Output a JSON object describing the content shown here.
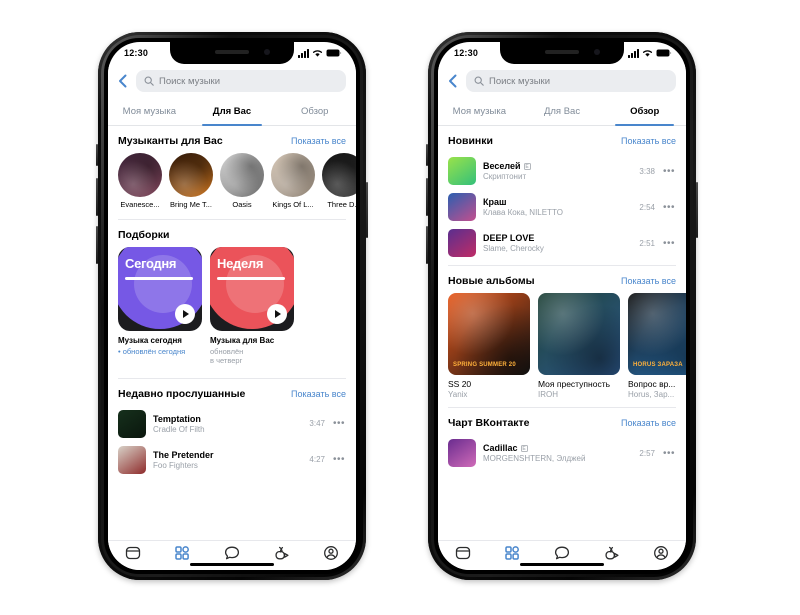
{
  "phones": [
    {
      "id": "phone-left",
      "status": {
        "time": "12:30",
        "signal_icon": "cellular-bars-icon",
        "wifi_icon": "wifi-icon",
        "battery_icon": "battery-full-icon"
      },
      "nav": {
        "back_icon": "back-chevron-icon"
      },
      "search": {
        "icon": "search-icon",
        "placeholder": "Поиск музыки",
        "value": ""
      },
      "tabs": [
        {
          "label": "Моя музыка",
          "active": false
        },
        {
          "label": "Для Вас",
          "active": true
        },
        {
          "label": "Обзор",
          "active": false
        }
      ],
      "sections": [
        {
          "kind": "artists",
          "title": "Музыканты для Вас",
          "link": "Показать все",
          "items": [
            {
              "name": "Evanesce...",
              "c1": "#3a2236",
              "c2": "#7d4458"
            },
            {
              "name": "Bring Me T...",
              "c1": "#2b1508",
              "c2": "#c8731f"
            },
            {
              "name": "Oasis",
              "c1": "#d8d8d8",
              "c2": "#6b6b6b"
            },
            {
              "name": "Kings Of L...",
              "c1": "#d9cbbb",
              "c2": "#8f8274"
            },
            {
              "name": "Three D...",
              "c1": "#141414",
              "c2": "#3d3d3d"
            }
          ]
        },
        {
          "kind": "cards",
          "title": "Подборки",
          "link": "",
          "items": [
            {
              "caption": "Сегодня",
              "title": "Музыка сегодня",
              "subtitle": "• обновлён сегодня",
              "subtitle_accent": true,
              "blob": "#7b5cf0",
              "bg": "#1c1c1f"
            },
            {
              "caption": "Неделя",
              "title": "Музыка для Вас",
              "subtitle": "обновлён\nв четверг",
              "subtitle_accent": false,
              "blob": "#f7565e",
              "bg": "#1c1c1f"
            }
          ]
        },
        {
          "kind": "tracks",
          "title": "Недавно прослушанные",
          "link": "Показать все",
          "items": [
            {
              "title": "Temptation",
              "artist": "Cradle Of Filth",
              "duration": "3:47",
              "explicit": false,
              "c1": "#16301c",
              "c2": "#0a160d"
            },
            {
              "title": "The Pretender",
              "artist": "Foo Fighters",
              "duration": "4:27",
              "explicit": false,
              "c1": "#d8d2c8",
              "c2": "#8e2b2b"
            }
          ]
        }
      ],
      "tabbar": [
        {
          "icon": "news-feed-icon",
          "active": false
        },
        {
          "icon": "services-grid-icon",
          "active": true
        },
        {
          "icon": "messages-bubble-icon",
          "active": false
        },
        {
          "icon": "clips-play-icon",
          "active": false
        },
        {
          "icon": "profile-avatar-icon",
          "active": false
        }
      ]
    },
    {
      "id": "phone-right",
      "status": {
        "time": "12:30",
        "signal_icon": "cellular-bars-icon",
        "wifi_icon": "wifi-icon",
        "battery_icon": "battery-full-icon"
      },
      "nav": {
        "back_icon": "back-chevron-icon"
      },
      "search": {
        "icon": "search-icon",
        "placeholder": "Поиск музыки",
        "value": ""
      },
      "tabs": [
        {
          "label": "Моя музыка",
          "active": false
        },
        {
          "label": "Для Вас",
          "active": false
        },
        {
          "label": "Обзор",
          "active": true
        }
      ],
      "sections": [
        {
          "kind": "tracks",
          "title": "Новинки",
          "link": "Показать все",
          "items": [
            {
              "title": "Веселей",
              "artist": "Скриптонит",
              "duration": "3:38",
              "explicit": true,
              "c1": "#9ae24a",
              "c2": "#33c07a"
            },
            {
              "title": "Краш",
              "artist": "Клава Кока, NILETTO",
              "duration": "2:54",
              "explicit": false,
              "c1": "#2b5fb0",
              "c2": "#c34f8e"
            },
            {
              "title": "DEEP LOVE",
              "artist": "Slame, Cherocky",
              "duration": "2:51",
              "explicit": false,
              "c1": "#5a2f8f",
              "c2": "#c02c66"
            }
          ]
        },
        {
          "kind": "albums",
          "title": "Новые альбомы",
          "link": "Показать все",
          "items": [
            {
              "title": "SS 20",
              "subtitle": "Yanix",
              "badge": "SPRING SUMMER 20",
              "c1": "#e8581a",
              "c2": "#141414"
            },
            {
              "title": "Моя преступность",
              "subtitle": "IROH",
              "badge": "",
              "c1": "#1e4136",
              "c2": "#2d5a8f"
            },
            {
              "title": "Вопрос вр...",
              "subtitle": "Horus, Зар...",
              "badge": "HORUS ЗАРАЗА",
              "c1": "#101010",
              "c2": "#2f7fc4"
            }
          ]
        },
        {
          "kind": "tracks",
          "title": "Чарт ВКонтакте",
          "link": "Показать все",
          "items": [
            {
              "title": "Cadillac",
              "artist": "MORGENSHTERN, Элджей",
              "duration": "2:57",
              "explicit": true,
              "c1": "#6a2c8f",
              "c2": "#d06bb8"
            }
          ]
        }
      ],
      "tabbar": [
        {
          "icon": "news-feed-icon",
          "active": false
        },
        {
          "icon": "services-grid-icon",
          "active": true
        },
        {
          "icon": "messages-bubble-icon",
          "active": false
        },
        {
          "icon": "clips-play-icon",
          "active": false
        },
        {
          "icon": "profile-avatar-icon",
          "active": false
        }
      ]
    }
  ],
  "colors": {
    "accent": "#4986cc",
    "text_primary": "#000000",
    "text_secondary": "#9aa0a8",
    "tab_inactive": "#818c99",
    "search_bg": "#ebedf0",
    "page_bg": "#ffffff"
  }
}
